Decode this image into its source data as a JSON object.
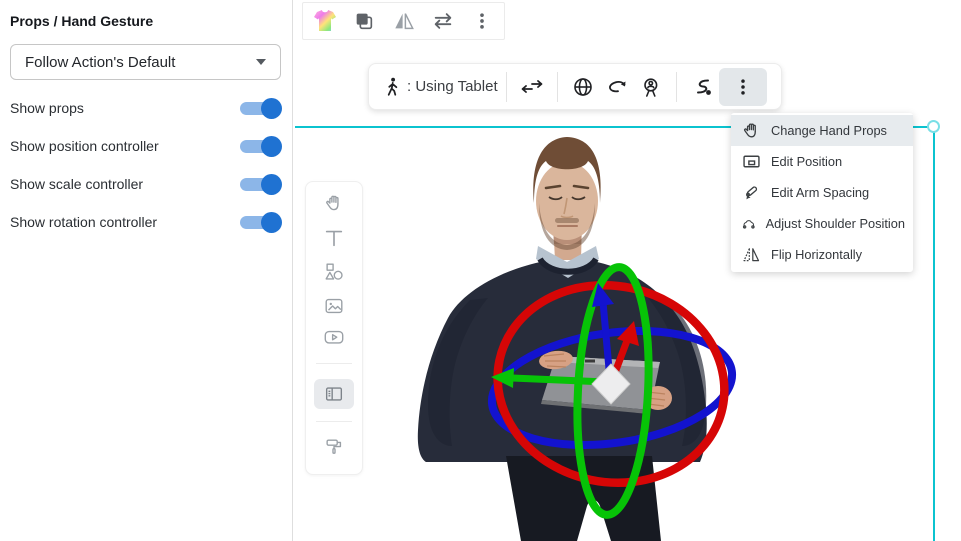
{
  "panel": {
    "title": "Props / Hand Gesture",
    "dropdown": {
      "value": "Follow Action's Default"
    },
    "toggles": [
      {
        "label": "Show props",
        "on": true
      },
      {
        "label": "Show position controller",
        "on": true
      },
      {
        "label": "Show scale controller",
        "on": true
      },
      {
        "label": "Show rotation controller",
        "on": true
      }
    ]
  },
  "object_toolbar": {
    "icons": [
      "shirt-color",
      "duplicate",
      "flip-horizontal",
      "swap-arrows",
      "more-vertical"
    ]
  },
  "action_toolbar": {
    "label": ": Using Tablet",
    "icons": [
      "walking-person",
      "width-arrows",
      "orbit-globe",
      "rotate-arrow",
      "inspect-person",
      "motion-path",
      "more-vertical"
    ],
    "active_icon": "more-vertical"
  },
  "context_menu": {
    "items": [
      {
        "label": "Change Hand Props",
        "icon": "hand",
        "highlighted": true
      },
      {
        "label": "Edit Position",
        "icon": "position-frame",
        "highlighted": false
      },
      {
        "label": "Edit Arm Spacing",
        "icon": "arm-cursor",
        "highlighted": false
      },
      {
        "label": "Adjust Shoulder Position",
        "icon": "shoulders",
        "highlighted": false
      },
      {
        "label": "Flip Horizontally",
        "icon": "flip-triangles",
        "highlighted": false
      }
    ]
  },
  "tool_palette": {
    "icons": [
      "hand-tool",
      "text-tool",
      "shapes-tool",
      "image-tool",
      "video-tool",
      "layout-tool",
      "paint-roller-tool"
    ],
    "selected": "layout-tool"
  },
  "colors": {
    "selection": "#0bc3cf",
    "toggle_on": "#1f72d2",
    "toggle_track": "#8cb6e8",
    "gizmo_red": "#d60606",
    "gizmo_green": "#07c307",
    "gizmo_blue": "#1313cf"
  }
}
